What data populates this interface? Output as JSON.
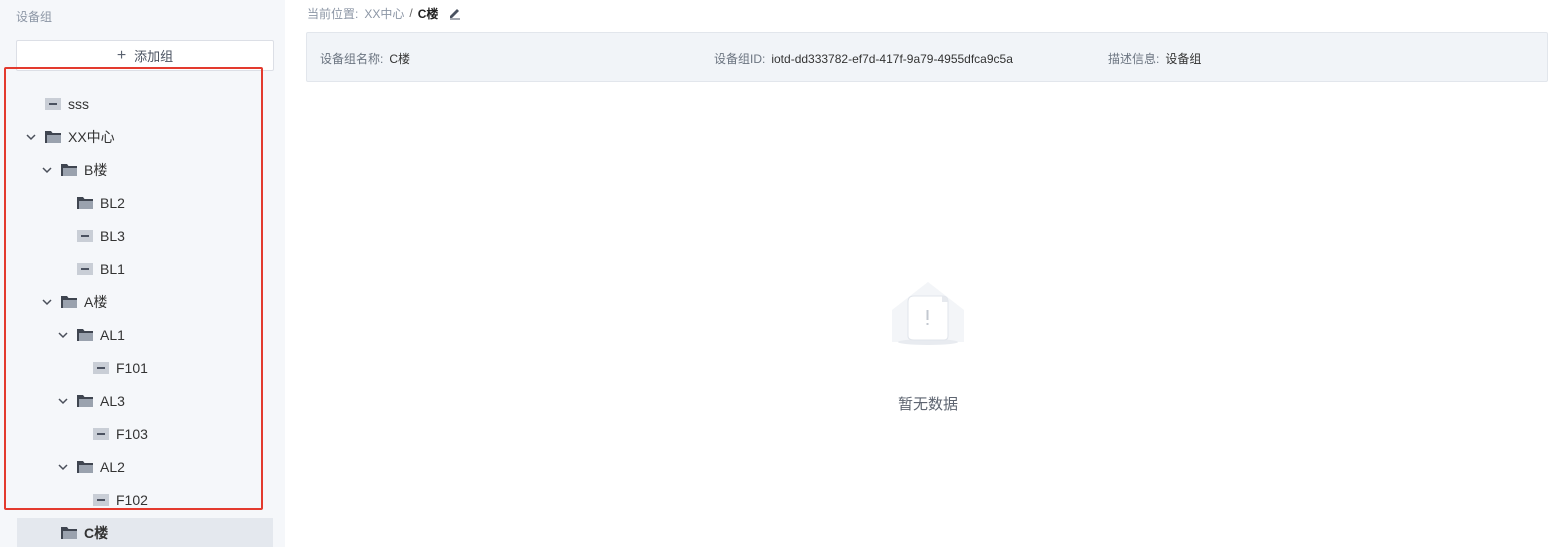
{
  "sidebar": {
    "title": "设备组",
    "add_label": "添加组"
  },
  "tree": [
    {
      "label": "sss"
    },
    {
      "label": "XX中心"
    },
    {
      "label": "B楼"
    },
    {
      "label": "BL2"
    },
    {
      "label": "BL3"
    },
    {
      "label": "BL1"
    },
    {
      "label": "A楼"
    },
    {
      "label": "AL1"
    },
    {
      "label": "F101"
    },
    {
      "label": "AL3"
    },
    {
      "label": "F103"
    },
    {
      "label": "AL2"
    },
    {
      "label": "F102"
    },
    {
      "label": "C楼"
    }
  ],
  "breadcrumb": {
    "prefix": "当前位置:",
    "parent": "XX中心",
    "sep": "/",
    "current": "C楼"
  },
  "info": {
    "name_key": "设备组名称:",
    "name_val": "C楼",
    "id_key": "设备组ID:",
    "id_val": "iotd-dd333782-ef7d-417f-9a79-4955dfca9c5a",
    "desc_key": "描述信息:",
    "desc_val": "设备组"
  },
  "empty": {
    "text": "暂无数据"
  },
  "colors": {
    "highlight_border": "#e33a2e",
    "sidebar_bg": "#f5f7fa",
    "selected_bg": "#e4e8ee"
  }
}
